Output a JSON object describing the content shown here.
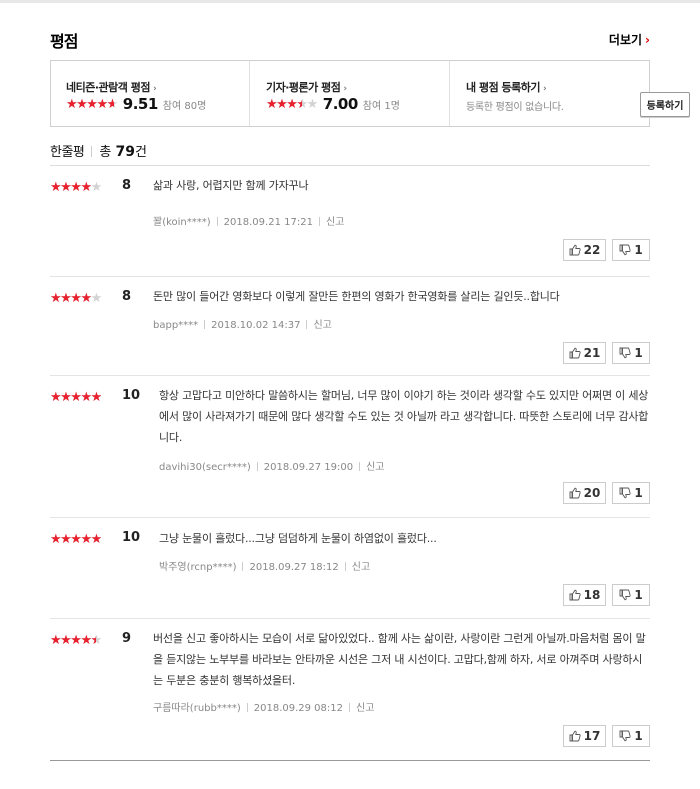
{
  "header": {
    "title": "평점",
    "more_label": "더보기",
    "more_arrow": "›"
  },
  "summary": {
    "netizen": {
      "label": "네티즌·관람객 평점",
      "arrow": "›",
      "score": "9.51",
      "participants": "참여 80명",
      "rating_fraction": 0.951
    },
    "critic": {
      "label": "기자·평론가 평점",
      "arrow": "›",
      "score": "7.00",
      "participants": "참여 1명",
      "rating_fraction": 0.7
    },
    "mine": {
      "label": "내 평점 등록하기",
      "arrow": "›",
      "empty_text": "등록한 평점이 없습니다.",
      "register_button": "등록하기"
    }
  },
  "review_header": {
    "label": "한줄평",
    "total_prefix": "총",
    "total": "79",
    "total_suffix": "건"
  },
  "star_glyphs": "★★★★★",
  "colors": {
    "accent": "#e8212f",
    "star_off": "#d3d3d3",
    "arrow": "#e50000"
  },
  "reviews": [
    {
      "score": "8",
      "rating_fraction": 0.8,
      "text": "삶과 사랑, 어렵지만 함께 가자꾸나",
      "author": "꽐(koin****)",
      "date": "2018.09.21 17:21",
      "report": "신고",
      "likes": "22",
      "dislikes": "1"
    },
    {
      "score": "8",
      "rating_fraction": 0.8,
      "text": "돈만 많이 들어간 영화보다 이렇게 잘만든 한편의 영화가 한국영화를 살리는 길인듯..합니다",
      "author": "bapp****",
      "date": "2018.10.02 14:37",
      "report": "신고",
      "likes": "21",
      "dislikes": "1"
    },
    {
      "score": "10",
      "rating_fraction": 1.0,
      "text": "항상 고맙다고 미안하다 말씀하시는 할머님, 너무 많이 이야기 하는 것이라 생각할 수도 있지만 어쩌면 이 세상에서 많이 사라져가기 때문에 많다 생각할 수도 있는 것 아닐까 라고 생각합니다. 따뜻한 스토리에 너무 감사합니다.",
      "author": "davihi30(secr****)",
      "date": "2018.09.27 19:00",
      "report": "신고",
      "likes": "20",
      "dislikes": "1"
    },
    {
      "score": "10",
      "rating_fraction": 1.0,
      "text": "그냥 눈물이 흘렀다...그냥 덤덤하게 눈물이 하염없이 흘렀다...",
      "author": "박주영(rcnp****)",
      "date": "2018.09.27 18:12",
      "report": "신고",
      "likes": "18",
      "dislikes": "1"
    },
    {
      "score": "9",
      "rating_fraction": 0.9,
      "text": "버선을 신고 좋아하시는 모습이 서로 닮아있었다.. 함께 사는 삶이란, 사랑이란 그런게 아닐까.마음처럼 몸이 말을 듣지않는 노부부를 바라보는 안타까운 시선은 그저 내 시선이다. 고맙다,함께 하자, 서로 아껴주며 사랑하시는 두분은 충분히 행복하셨을터.",
      "author": "구름따라(rubb****)",
      "date": "2018.09.29 08:12",
      "report": "신고",
      "likes": "17",
      "dislikes": "1"
    }
  ]
}
